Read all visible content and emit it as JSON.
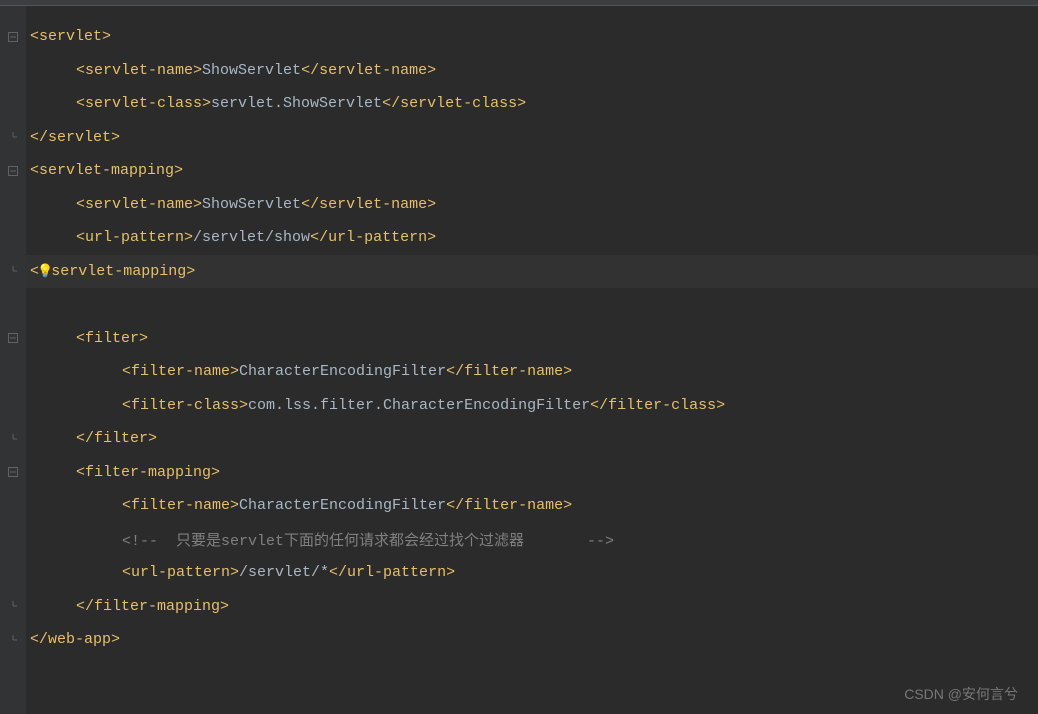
{
  "watermark": "CSDN @安何言兮",
  "lines": [
    {
      "indent": 0,
      "gutter": "minus",
      "tokens": [
        {
          "t": "tag",
          "v": "<servlet>"
        }
      ]
    },
    {
      "indent": 1,
      "gutter": "",
      "tokens": [
        {
          "t": "tag",
          "v": "<servlet-name>"
        },
        {
          "t": "text",
          "v": "ShowServlet"
        },
        {
          "t": "tag",
          "v": "</servlet-name>"
        }
      ]
    },
    {
      "indent": 1,
      "gutter": "",
      "tokens": [
        {
          "t": "tag",
          "v": "<servlet-class>"
        },
        {
          "t": "text",
          "v": "servlet.ShowServlet"
        },
        {
          "t": "tag",
          "v": "</servlet-class>"
        }
      ]
    },
    {
      "indent": 0,
      "gutter": "end",
      "tokens": [
        {
          "t": "tag",
          "v": "</servlet>"
        }
      ]
    },
    {
      "indent": 0,
      "gutter": "minus",
      "tokens": [
        {
          "t": "tag",
          "v": "<servlet-mapping>"
        }
      ]
    },
    {
      "indent": 1,
      "gutter": "",
      "tokens": [
        {
          "t": "tag",
          "v": "<servlet-name>"
        },
        {
          "t": "text",
          "v": "ShowServlet"
        },
        {
          "t": "tag",
          "v": "</servlet-name>"
        }
      ]
    },
    {
      "indent": 1,
      "gutter": "",
      "tokens": [
        {
          "t": "tag",
          "v": "<url-pattern>"
        },
        {
          "t": "text",
          "v": "/servlet/show"
        },
        {
          "t": "tag",
          "v": "</url-pattern>"
        }
      ]
    },
    {
      "indent": 0,
      "gutter": "bulb",
      "hl": true,
      "tokens": [
        {
          "t": "tag",
          "v": "<"
        },
        {
          "t": "bulbpad",
          "v": ""
        },
        {
          "t": "tag",
          "v": "servlet-mapping>"
        }
      ]
    },
    {
      "indent": 0,
      "gutter": "",
      "tokens": []
    },
    {
      "indent": 1,
      "gutter": "minus",
      "tokens": [
        {
          "t": "tag",
          "v": "<filter>"
        }
      ]
    },
    {
      "indent": 2,
      "gutter": "",
      "tokens": [
        {
          "t": "tag",
          "v": "<filter-name>"
        },
        {
          "t": "text",
          "v": "CharacterEncodingFilter"
        },
        {
          "t": "tag",
          "v": "</filter-name>"
        }
      ]
    },
    {
      "indent": 2,
      "gutter": "",
      "tokens": [
        {
          "t": "tag",
          "v": "<filter-class>"
        },
        {
          "t": "text",
          "v": "com.lss.filter.CharacterEncodingFilter"
        },
        {
          "t": "tag",
          "v": "</filter-class>"
        }
      ]
    },
    {
      "indent": 1,
      "gutter": "end",
      "tokens": [
        {
          "t": "tag",
          "v": "</filter>"
        }
      ]
    },
    {
      "indent": 1,
      "gutter": "minus",
      "tokens": [
        {
          "t": "tag",
          "v": "<filter-mapping>"
        }
      ]
    },
    {
      "indent": 2,
      "gutter": "",
      "tokens": [
        {
          "t": "tag",
          "v": "<filter-name>"
        },
        {
          "t": "text",
          "v": "CharacterEncodingFilter"
        },
        {
          "t": "tag",
          "v": "</filter-name>"
        }
      ]
    },
    {
      "indent": 2,
      "gutter": "",
      "tokens": [
        {
          "t": "comment",
          "v": "<!--  只要是servlet下面的任何请求都会经过找个过滤器       -->"
        }
      ]
    },
    {
      "indent": 2,
      "gutter": "",
      "tokens": [
        {
          "t": "tag",
          "v": "<url-pattern>"
        },
        {
          "t": "text",
          "v": "/servlet/*"
        },
        {
          "t": "tag",
          "v": "</url-pattern>"
        }
      ]
    },
    {
      "indent": 1,
      "gutter": "end",
      "tokens": [
        {
          "t": "tag",
          "v": "</filter-mapping>"
        }
      ]
    },
    {
      "indent": 0,
      "gutter": "end",
      "tokens": [
        {
          "t": "tag",
          "v": "</web-app>"
        }
      ]
    }
  ]
}
